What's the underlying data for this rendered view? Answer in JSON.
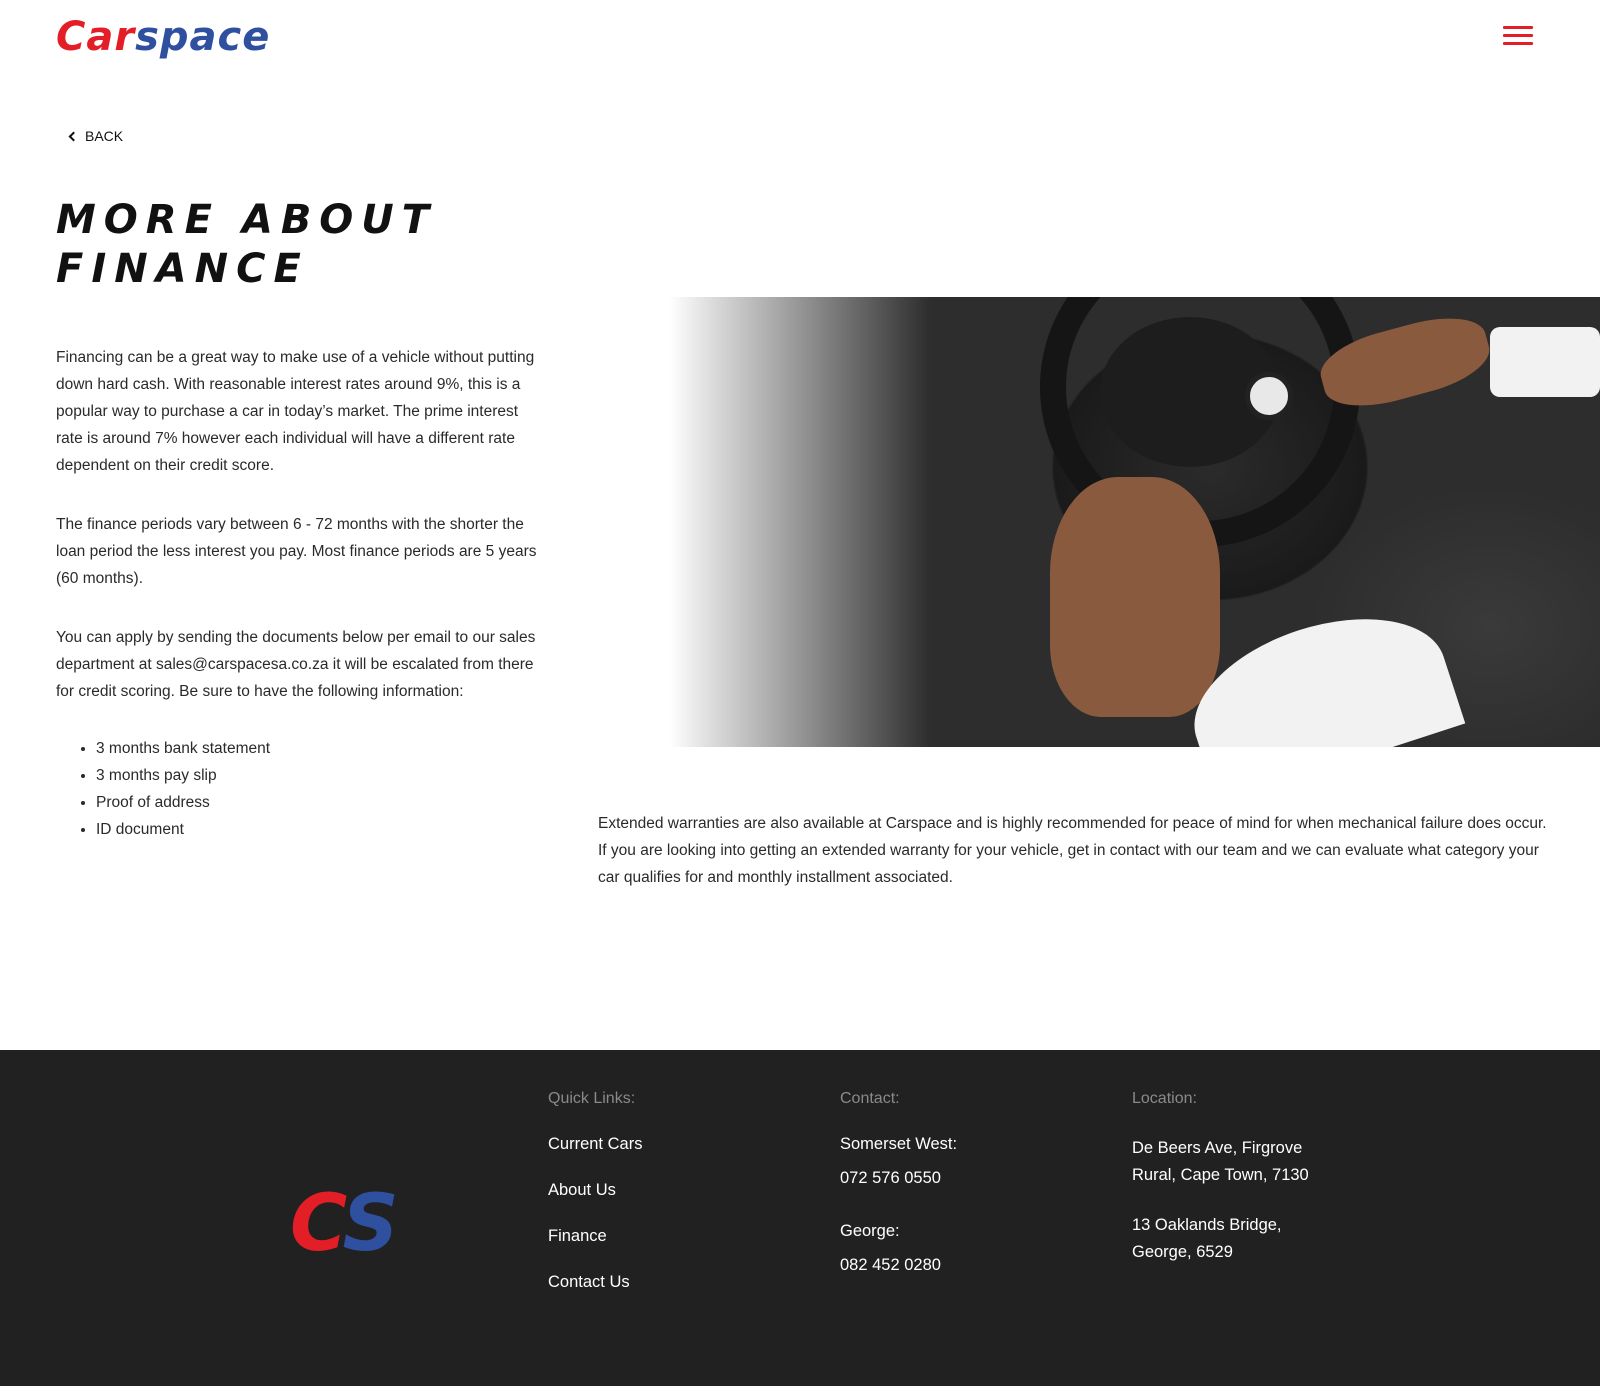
{
  "header": {
    "logo_car": "Car",
    "logo_space": "space"
  },
  "back_label": "BACK",
  "title": {
    "line1": "MORE ABOUT",
    "line2": "FINANCE"
  },
  "content": {
    "p1": "Financing can be a great way to make use of a vehicle without putting down hard cash. With reasonable interest rates around 9%, this is a popular way to purchase a car in today’s market. The prime interest rate is around 7% however each individual will have a different rate dependent on their credit score.",
    "p2": "The finance periods vary between 6 - 72 months with the shorter the loan period the less interest you pay. Most finance periods are 5 years (60 months).",
    "p3": "You can apply by sending the documents below per email to our sales department at sales@carspacesa.co.za it will be escalated from there for credit scoring. Be sure to have the following information:",
    "docs": [
      "3 months bank statement",
      "3 months pay slip",
      "Proof of address",
      "ID document"
    ],
    "warranty": "Extended warranties are also available at Carspace and is highly recommended for peace of mind for when mechanical failure does occur. If you are looking into getting an extended warranty for your vehicle, get in contact with our team and we can evaluate what category your car qualifies for and monthly installment associated."
  },
  "footer": {
    "logo_c": "C",
    "logo_s": "S",
    "quick_links_heading": "Quick Links:",
    "links": [
      "Current Cars",
      "About Us",
      "Finance",
      "Contact Us"
    ],
    "contact_heading": "Contact:",
    "contacts": [
      {
        "place": "Somerset West:",
        "phone": "072 576 0550"
      },
      {
        "place": "George:",
        "phone": "082 452 0280"
      }
    ],
    "location_heading": "Location:",
    "locations": [
      "De Beers Ave, Firgrove Rural, Cape Town, 7130",
      "13 Oaklands Bridge, George, 6529"
    ]
  },
  "colors": {
    "brand_red": "#e41e26",
    "brand_blue": "#2f4f9f",
    "footer_bg": "#212121"
  },
  "icons": {
    "menu": "hamburger-menu-icon",
    "back": "chevron-left-icon"
  }
}
